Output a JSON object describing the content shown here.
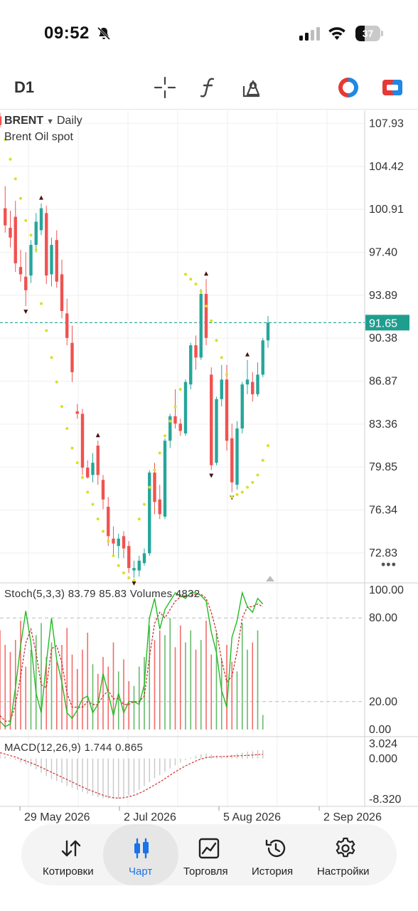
{
  "status_bar": {
    "time": "09:52",
    "battery": "37",
    "battery_level": 0.37
  },
  "toolbar": {
    "timeframe": "D1",
    "icons": [
      "crosshair-icon",
      "function-icon",
      "drawing-tools-icon",
      "one-click-trading-icon",
      "trade-panel-icon"
    ]
  },
  "chart": {
    "symbol": "BRENT",
    "period": "Daily",
    "description": "Brent Oil spot",
    "current_price": "91.65",
    "colors": {
      "up": "#26a69a",
      "down": "#ef5350",
      "sar": "#d9e021",
      "stoch_main": "#22bb22",
      "stoch_signal": "#cc2222",
      "price_line": "#1f9e8f"
    },
    "price_axis": [
      "107.93",
      "104.42",
      "100.91",
      "97.40",
      "93.89",
      "90.38",
      "86.87",
      "83.36",
      "79.85",
      "76.34",
      "72.83"
    ],
    "stoch_label": "Stoch(5,3,3) 83.79 85.83 Volumes 4832",
    "stoch_axis": [
      "100.00",
      "80.00",
      "20.00",
      "0.00"
    ],
    "macd_label": "MACD(12,26,9) 1.744 0.865",
    "macd_axis": [
      "3.024",
      "0.000",
      "-8.320"
    ],
    "date_axis": [
      "29 May 2026",
      "2 Jul 2026",
      "5 Aug 2026",
      "2 Sep 2026"
    ]
  },
  "chart_data": {
    "type": "candlestick",
    "title": "BRENT Daily",
    "ylim": [
      70.5,
      109
    ],
    "candles": [
      [
        108.5,
        108.8,
        107.6,
        107.8
      ],
      [
        101.0,
        102.8,
        99.0,
        99.6
      ],
      [
        99.4,
        100.8,
        97.8,
        98.6
      ],
      [
        100.3,
        101.6,
        95.8,
        96.5
      ],
      [
        96.2,
        97.6,
        95.0,
        95.6
      ],
      [
        95.4,
        97.4,
        93.0,
        94.3
      ],
      [
        95.5,
        98.4,
        94.9,
        98.0
      ],
      [
        98.0,
        100.6,
        97.4,
        99.9
      ],
      [
        99.2,
        101.4,
        98.8,
        101.0
      ],
      [
        100.6,
        101.2,
        94.8,
        95.5
      ],
      [
        95.6,
        98.6,
        94.6,
        98.0
      ],
      [
        98.4,
        99.2,
        94.5,
        95.0
      ],
      [
        95.6,
        96.8,
        92.0,
        92.6
      ],
      [
        92.4,
        93.6,
        89.8,
        90.4
      ],
      [
        90.0,
        91.4,
        86.8,
        87.6
      ],
      [
        84.4,
        85.0,
        83.8,
        84.2
      ],
      [
        84.2,
        84.6,
        79.2,
        79.8
      ],
      [
        79.8,
        80.4,
        78.9,
        79.0
      ],
      [
        79.2,
        81.0,
        78.6,
        80.2
      ],
      [
        81.6,
        82.0,
        78.4,
        79.2
      ],
      [
        78.8,
        79.2,
        76.4,
        77.2
      ],
      [
        76.6,
        77.4,
        73.4,
        74.2
      ],
      [
        74.0,
        75.0,
        72.6,
        73.6
      ],
      [
        73.4,
        74.4,
        72.4,
        74.0
      ],
      [
        74.2,
        74.6,
        72.4,
        73.2
      ],
      [
        73.4,
        73.8,
        71.2,
        71.6
      ],
      [
        71.4,
        72.2,
        70.8,
        71.6
      ],
      [
        71.4,
        72.6,
        70.9,
        72.2
      ],
      [
        72.0,
        73.2,
        71.8,
        72.8
      ],
      [
        72.8,
        79.6,
        72.6,
        79.4
      ],
      [
        79.4,
        80.2,
        76.0,
        77.0
      ],
      [
        77.2,
        78.4,
        75.6,
        76.0
      ],
      [
        75.8,
        82.2,
        75.6,
        82.0
      ],
      [
        82.0,
        84.2,
        81.4,
        84.0
      ],
      [
        84.0,
        86.2,
        83.0,
        83.4
      ],
      [
        83.4,
        83.8,
        82.4,
        82.8
      ],
      [
        82.6,
        87.0,
        82.4,
        86.8
      ],
      [
        86.6,
        90.0,
        86.2,
        89.8
      ],
      [
        89.8,
        90.6,
        87.8,
        88.8
      ],
      [
        88.8,
        94.4,
        88.6,
        94.0
      ],
      [
        94.0,
        95.2,
        89.8,
        90.4
      ],
      [
        87.4,
        88.0,
        79.6,
        80.0
      ],
      [
        80.2,
        85.6,
        80.0,
        85.4
      ],
      [
        85.4,
        88.2,
        84.8,
        87.0
      ],
      [
        87.0,
        88.2,
        81.2,
        82.0
      ],
      [
        82.2,
        83.4,
        77.8,
        78.6
      ],
      [
        78.4,
        83.6,
        78.0,
        83.0
      ],
      [
        83.0,
        86.8,
        82.6,
        86.6
      ],
      [
        86.6,
        88.6,
        85.8,
        87.0
      ],
      [
        86.8,
        87.6,
        85.2,
        85.8
      ],
      [
        85.8,
        88.4,
        85.6,
        87.4
      ],
      [
        87.4,
        90.4,
        87.2,
        90.2
      ],
      [
        90.2,
        92.2,
        89.6,
        91.65
      ]
    ],
    "parabolic_sar": [
      106.6,
      105.0,
      103.4,
      101.8,
      100.0,
      98.8,
      97.6,
      93.2,
      91.0,
      88.8,
      86.8,
      84.8,
      83.0,
      81.4,
      80.2,
      79.0,
      77.8,
      76.8,
      75.6,
      74.6,
      73.8,
      72.6,
      71.8,
      71.2,
      70.8,
      70.6,
      75.6,
      76.8,
      78.2,
      79.6,
      81.0,
      82.4,
      83.6,
      84.8,
      86.2,
      95.6,
      95.2,
      94.8,
      94.2,
      93.0,
      91.8,
      90.2,
      88.8,
      87.4,
      77.4,
      77.6,
      77.8,
      78.2,
      78.6,
      79.2,
      80.4,
      81.6
    ],
    "sar_start_index": 1,
    "stochastic": {
      "main": [
        6,
        2,
        4,
        30,
        60,
        85,
        62,
        26,
        12,
        48,
        80,
        50,
        34,
        12,
        8,
        14,
        22,
        24,
        12,
        18,
        40,
        26,
        10,
        26,
        12,
        20,
        20,
        18,
        32,
        80,
        94,
        72,
        86,
        92,
        98,
        96,
        94,
        98,
        98,
        96,
        92,
        70,
        55,
        28,
        16,
        66,
        78,
        98,
        88,
        84,
        94,
        90
      ],
      "signal": [
        10,
        6,
        6,
        18,
        38,
        62,
        72,
        55,
        32,
        30,
        58,
        60,
        48,
        26,
        16,
        16,
        16,
        20,
        18,
        18,
        24,
        28,
        22,
        22,
        18,
        18,
        20,
        20,
        24,
        52,
        76,
        84,
        80,
        86,
        92,
        95,
        96,
        96,
        97,
        97,
        94,
        84,
        70,
        50,
        34,
        38,
        56,
        80,
        88,
        88,
        90,
        88
      ],
      "ylim": [
        0,
        100
      ],
      "levels": [
        80,
        20
      ]
    },
    "volumes": [
      0.82,
      0.7,
      0.64,
      0.74,
      0.9,
      0.52,
      0.66,
      0.78,
      0.88,
      0.6,
      0.72,
      0.56,
      0.7,
      0.84,
      0.62,
      0.5,
      0.66,
      0.8,
      0.54,
      0.46,
      0.6,
      0.52,
      0.72,
      0.48,
      0.58,
      0.4,
      0.36,
      0.52,
      0.6,
      0.86,
      0.74,
      0.82,
      0.78,
      0.92,
      0.68,
      0.86,
      0.72,
      0.82,
      0.66,
      0.74,
      0.9,
      0.62,
      0.8,
      0.58,
      0.7,
      0.56,
      0.48,
      0.88,
      0.66,
      0.72,
      0.82,
      0.12
    ],
    "macd": {
      "histogram": [
        0.9,
        0.5,
        0.2,
        -0.3,
        -0.8,
        -1.2,
        -1.6,
        -2.2,
        -2.9,
        -3.6,
        -4.2,
        -4.6,
        -5.0,
        -5.6,
        -6.0,
        -6.4,
        -6.8,
        -7.2,
        -7.6,
        -7.9,
        -8.1,
        -8.2,
        -8.3,
        -8.2,
        -8.0,
        -7.5,
        -7.0,
        -6.4,
        -5.6,
        -4.8,
        -4.0,
        -3.4,
        -2.7,
        -2.0,
        -1.4,
        -0.8,
        -0.3,
        0.2,
        0.6,
        0.9,
        1.0,
        0.8,
        0.6,
        0.5,
        0.6,
        0.8,
        1.0,
        1.2,
        1.4,
        1.5,
        1.7,
        1.744
      ],
      "signal": [
        1.2,
        0.9,
        0.6,
        0.3,
        -0.1,
        -0.5,
        -0.9,
        -1.3,
        -1.8,
        -2.3,
        -2.8,
        -3.3,
        -3.8,
        -4.3,
        -4.8,
        -5.3,
        -5.8,
        -6.3,
        -6.7,
        -7.1,
        -7.5,
        -7.8,
        -8.0,
        -8.1,
        -8.0,
        -7.8,
        -7.5,
        -7.1,
        -6.6,
        -6.0,
        -5.4,
        -4.8,
        -4.1,
        -3.4,
        -2.7,
        -2.1,
        -1.5,
        -1.0,
        -0.5,
        -0.1,
        0.2,
        0.3,
        0.4,
        0.4,
        0.45,
        0.5,
        0.55,
        0.6,
        0.65,
        0.72,
        0.8,
        0.865
      ],
      "ylim": [
        -8.32,
        3.024
      ]
    }
  },
  "bottom_nav": [
    {
      "label": "Котировки",
      "icon": "quotes-icon",
      "active": false
    },
    {
      "label": "Чарт",
      "icon": "chart-icon",
      "active": true
    },
    {
      "label": "Торговля",
      "icon": "trade-icon",
      "active": false
    },
    {
      "label": "История",
      "icon": "history-icon",
      "active": false
    },
    {
      "label": "Настройки",
      "icon": "settings-icon",
      "active": false
    }
  ]
}
